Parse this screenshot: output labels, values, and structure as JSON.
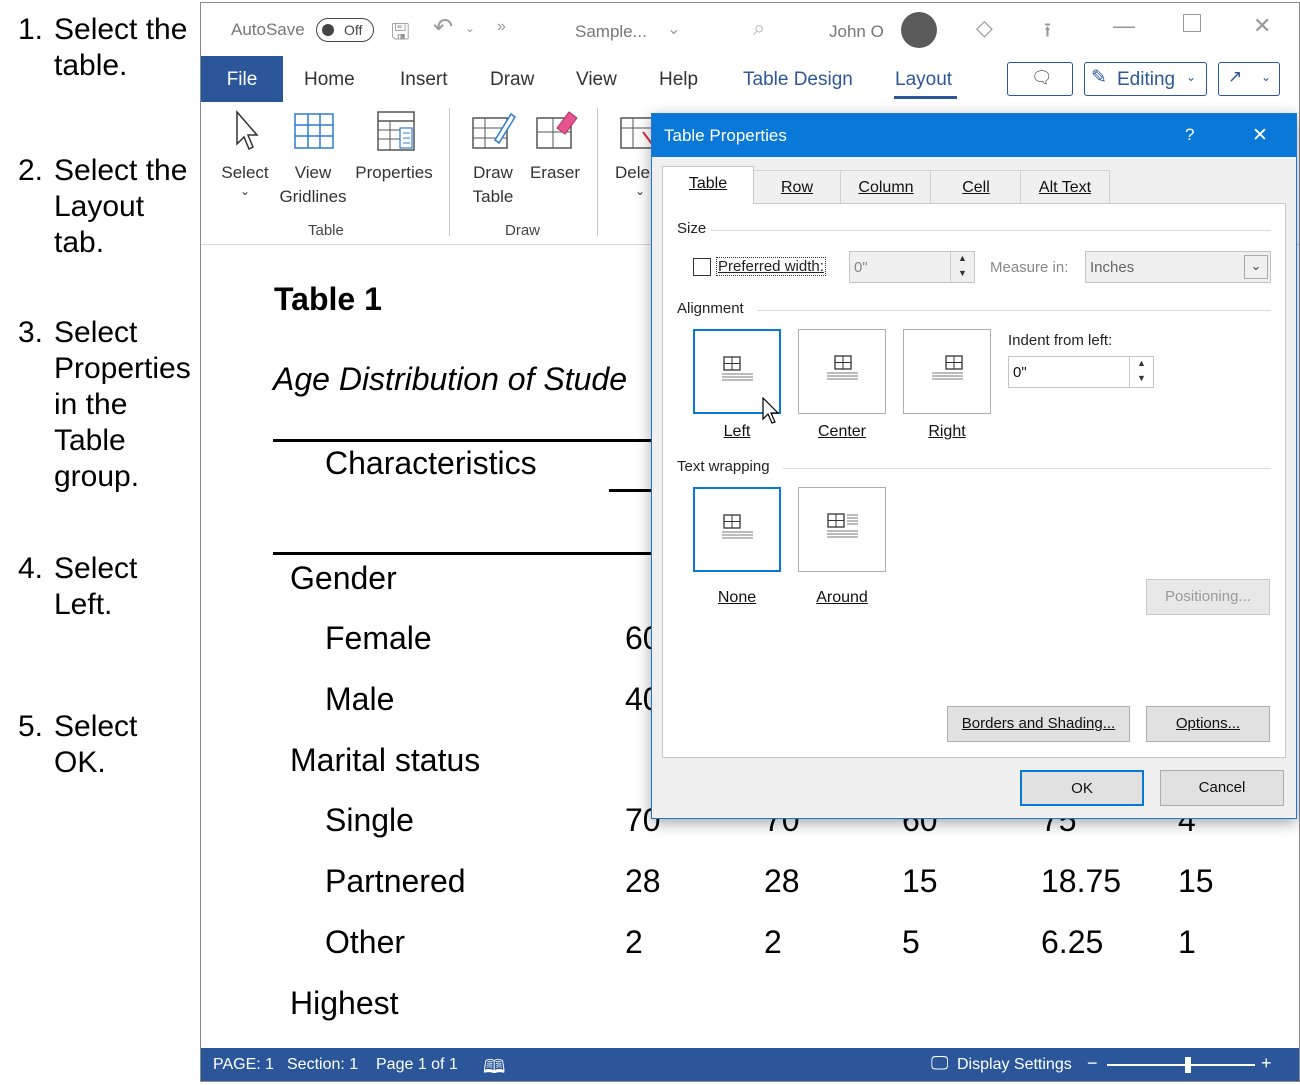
{
  "instructions": [
    {
      "num": "1.",
      "text": "Select the\ntable."
    },
    {
      "num": "2.",
      "text": "Select the\nLayout\ntab."
    },
    {
      "num": "3.",
      "text": "Select\nProperties\nin the\nTable\ngroup."
    },
    {
      "num": "4.",
      "text": "Select\nLeft."
    },
    {
      "num": "5.",
      "text": "Select\nOK."
    }
  ],
  "titlebar": {
    "autosave_label": "AutoSave",
    "autosave_state": "Off",
    "doc_name": "Sample...",
    "user_name": "John O"
  },
  "ribbon_tabs": [
    "File",
    "Home",
    "Insert",
    "Draw",
    "View",
    "Help",
    "Table Design",
    "Layout"
  ],
  "ribbon_right": {
    "editing_label": "Editing"
  },
  "ribbon": {
    "select": "Select",
    "view_gridlines_1": "View",
    "view_gridlines_2": "Gridlines",
    "properties": "Properties",
    "draw_table_1": "Draw",
    "draw_table_2": "Table",
    "eraser": "Eraser",
    "delete_partial": "Dele",
    "group_table": "Table",
    "group_draw": "Draw"
  },
  "document": {
    "table_title": "Table 1",
    "table_subtitle": "Age Distribution of Stude",
    "col_header": "Characteristics",
    "rows": [
      {
        "label": "Gender",
        "indent": false,
        "values": []
      },
      {
        "label": "Female",
        "indent": true,
        "values": [
          "60"
        ]
      },
      {
        "label": "Male",
        "indent": true,
        "values": [
          "40"
        ]
      },
      {
        "label": "Marital status",
        "indent": false,
        "values": []
      },
      {
        "label": "Single",
        "indent": true,
        "values": [
          "70",
          "70",
          "60",
          "75",
          "4"
        ]
      },
      {
        "label": "Partnered",
        "indent": true,
        "values": [
          "28",
          "28",
          "15",
          "18.75",
          "15"
        ]
      },
      {
        "label": "Other",
        "indent": true,
        "values": [
          "2",
          "2",
          "5",
          "6.25",
          "1"
        ]
      },
      {
        "label": "Highest",
        "indent": false,
        "values": []
      }
    ]
  },
  "statusbar": {
    "page": "PAGE: 1",
    "section": "Section: 1",
    "page_of": "Page 1 of 1",
    "display_settings": "Display Settings",
    "zoom_minus": "−",
    "zoom_plus": "+"
  },
  "dialog": {
    "title": "Table Properties",
    "help": "?",
    "close": "✕",
    "tabs": [
      "Table",
      "Row",
      "Column",
      "Cell",
      "Alt Text"
    ],
    "active_tab": "Table",
    "size_label": "Size",
    "preferred_width_label": "Preferred width:",
    "preferred_width_value": "0\"",
    "measure_in_label": "Measure in:",
    "measure_in_value": "Inches",
    "alignment_label": "Alignment",
    "align_options": [
      "Left",
      "Center",
      "Right"
    ],
    "align_selected": "Left",
    "indent_label": "Indent from left:",
    "indent_value": "0\"",
    "wrapping_label": "Text wrapping",
    "wrap_options": [
      "None",
      "Around"
    ],
    "wrap_selected": "None",
    "positioning_button": "Positioning...",
    "borders_button": "Borders and Shading...",
    "options_button": "Options...",
    "ok_button": "OK",
    "cancel_button": "Cancel"
  },
  "colors": {
    "word_blue": "#2b579a",
    "dialog_title_blue": "#0a78d7",
    "layout_tab": "#2b579a"
  }
}
